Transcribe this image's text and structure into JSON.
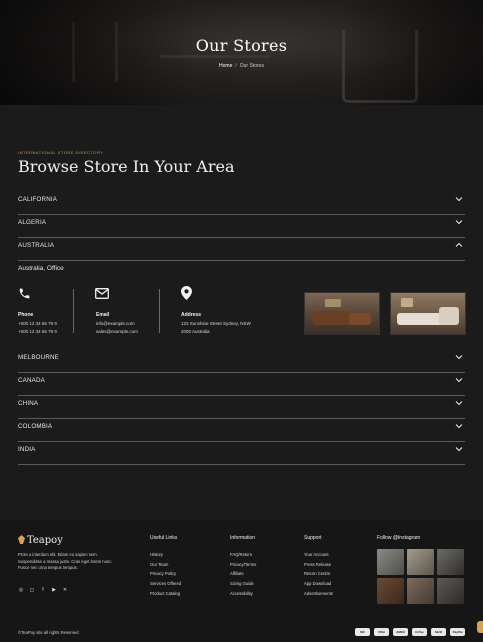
{
  "hero": {
    "title": "Our Stores",
    "crumb_home": "Home",
    "crumb_sep": "/",
    "crumb_current": "Our Stores"
  },
  "section": {
    "eyebrow": "INTERNATIONAL STORE DIRECTORY",
    "title": "Browse Store In Your Area"
  },
  "regions_top": [
    {
      "label": "CALIFORNIA",
      "open": false
    },
    {
      "label": "ALGERIA",
      "open": false
    },
    {
      "label": "AUSTRALIA",
      "open": true
    }
  ],
  "office": {
    "title": "Australia, Office",
    "phone": {
      "label": "Phone",
      "lines": [
        "+000 12 34 56 78 9",
        "+000 12 34 56 78 9"
      ],
      "icon": "phone-icon"
    },
    "email": {
      "label": "Email",
      "lines": [
        "info@example.com",
        "sales@example.com"
      ],
      "icon": "envelope-icon"
    },
    "address": {
      "label": "Address",
      "lines": [
        "123 Sunshine Street Sydney, NSW",
        "2000 Australia"
      ],
      "icon": "map-pin-icon"
    }
  },
  "regions_bottom": [
    {
      "label": "MELBOURNE"
    },
    {
      "label": "CANADA"
    },
    {
      "label": "CHINA"
    },
    {
      "label": "COLOMBIA"
    },
    {
      "label": "INDIA"
    }
  ],
  "footer": {
    "brand": "Teapoy",
    "about": "Proin a interdum elit. Etiam eu sapien sem. Suspendisse a massa justo. Cras eget lorem nunc. Fusce nec urna tempus tempus.",
    "social": [
      "dribbble-icon",
      "instagram-icon",
      "facebook-icon",
      "youtube-icon",
      "x-icon"
    ],
    "columns": [
      {
        "heading": "Useful Links",
        "links": [
          "History",
          "Our Team",
          "Privacy Policy",
          "Services Offered",
          "Product Catalog"
        ]
      },
      {
        "heading": "Information",
        "links": [
          "FAQ/Return",
          "Privacy/Terms",
          "Affiliate",
          "Sizing Guide",
          "Accessibility"
        ]
      },
      {
        "heading": "Support",
        "links": [
          "Your Account",
          "Press Release",
          "Return Centre",
          "App Download",
          "Advertisements"
        ]
      }
    ],
    "instagram_heading": "Follow @Instagram",
    "copyright": "©TeaPoy site all rights Reserved",
    "payments": [
      "MC",
      "VISA",
      "AMEX",
      "G Pay",
      "Skrill",
      "PayPal"
    ]
  },
  "colors": {
    "accent": "#c99a4a",
    "background": "#1b1b1b",
    "divider": "#5a5a5a"
  }
}
